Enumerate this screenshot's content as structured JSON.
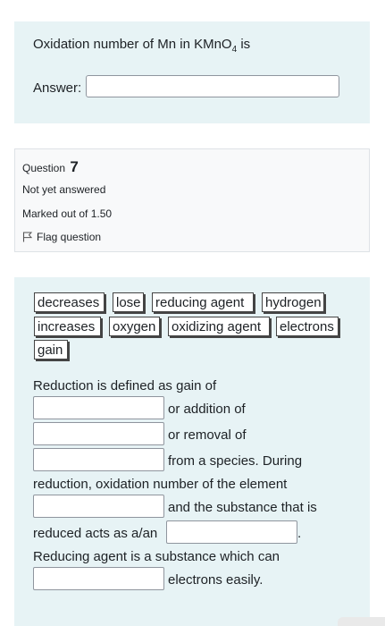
{
  "q6": {
    "text_prefix": "Oxidation number of Mn in KMnO",
    "subscript": "4",
    "text_suffix": " is",
    "answer_label": "Answer:"
  },
  "q7_info": {
    "question_label": "Question",
    "question_number": "7",
    "status": "Not yet answered",
    "marks": "Marked out of 1.50",
    "flag_label": "Flag question"
  },
  "choices": [
    "decreases",
    "lose",
    "reducing agent",
    "hydrogen",
    "increases",
    "oxygen",
    "oxidizing agent",
    "electrons",
    "gain"
  ],
  "passage": {
    "line1": "Reduction is defined as gain of",
    "after_blank1": "or addition of",
    "after_blank2": "or removal of",
    "after_blank3": "from a species. During",
    "line2": "reduction, oxidation number of the element",
    "after_blank4": "and the substance that is",
    "line3": "reduced acts as a/an",
    "after_blank5": ".",
    "line4": "Reducing agent is a substance which can",
    "after_blank6": "electrons easily."
  }
}
